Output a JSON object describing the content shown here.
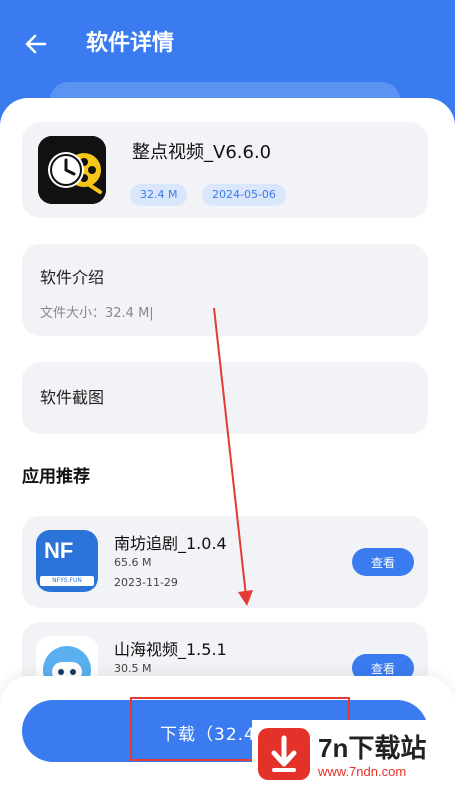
{
  "header": {
    "title": "软件详情"
  },
  "app": {
    "name": "整点视频_V6.6.0",
    "size": "32.4 M",
    "date": "2024-05-06"
  },
  "intro": {
    "heading": "软件介绍",
    "text": "文件大小：32.4 M|"
  },
  "screenshots": {
    "heading": "软件截图"
  },
  "recommend": {
    "title": "应用推荐",
    "items": [
      {
        "name": "南坊追剧_1.0.4",
        "size": "65.6 M",
        "date": "2023-11-29",
        "button": "查看",
        "icon_text": "NF",
        "icon_sub": "NFYS.FUN"
      },
      {
        "name": "山海视频_1.5.1",
        "size": "30.5 M",
        "date": "",
        "button": "查看"
      }
    ]
  },
  "download": {
    "label": "下载（32.4"
  },
  "watermark": {
    "name": "7n下载站",
    "url": "www.7ndn.com"
  },
  "colors": {
    "primary": "#3a7bf0",
    "annotation": "#e33a34",
    "watermark_red": "#e4322b"
  }
}
